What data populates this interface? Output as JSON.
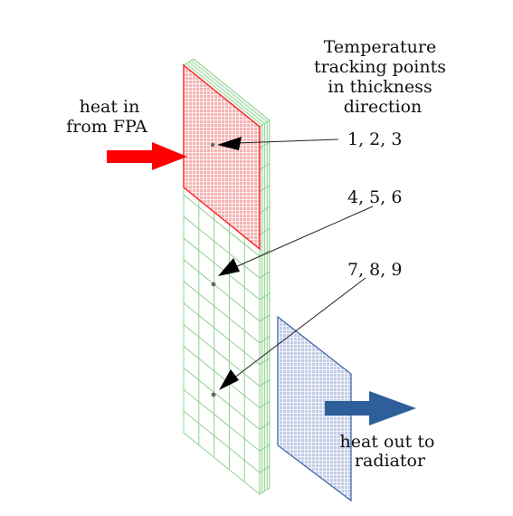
{
  "labels": {
    "heat_in": [
      "heat in",
      "from FPA"
    ],
    "tracking_title": [
      "Temperature",
      "tracking points",
      "in thickness",
      "direction"
    ],
    "points_1": "1, 2, 3",
    "points_2": "4, 5, 6",
    "points_3": "7, 8, 9",
    "heat_out": [
      "heat out to",
      "radiator"
    ]
  },
  "colors": {
    "panel_mesh": "#8fd08f",
    "heat_source": "#ff2020",
    "heat_source_fill": "#f7b8b8",
    "radiator": "#3a5fa8",
    "radiator_fill": "#c9d3ea",
    "arrow_in": "#ff0000",
    "arrow_out": "#2f5f9a"
  }
}
